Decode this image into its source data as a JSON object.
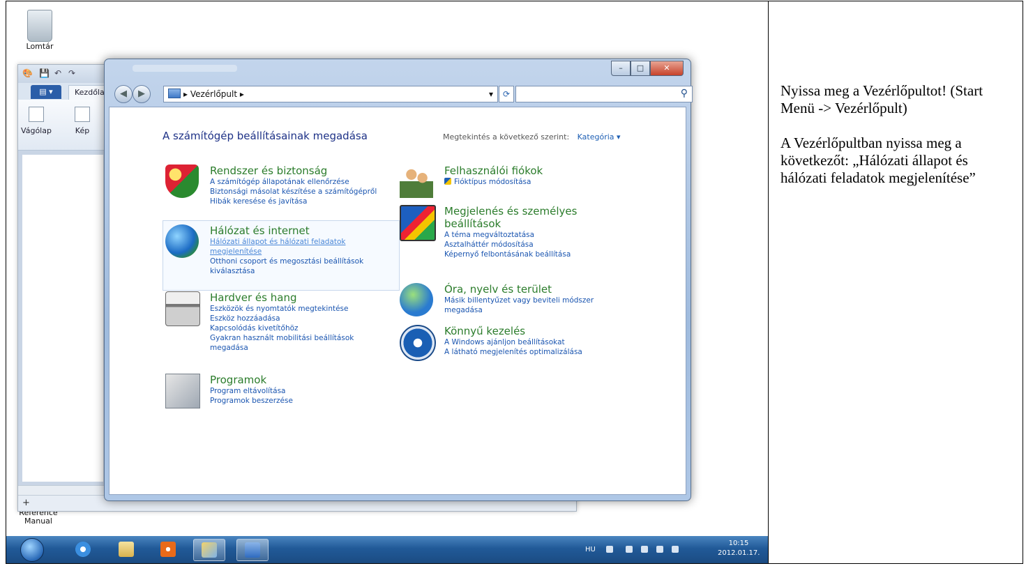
{
  "desktop": {
    "icons": [
      {
        "label": "Lomtár"
      },
      {
        "label": "Reference Manual"
      }
    ]
  },
  "paint": {
    "home_tab": "Kezdőlap",
    "groups": [
      "Vágólap",
      "Kép"
    ],
    "status_text": "+"
  },
  "control_panel": {
    "address": "Vezérlőpult",
    "heading": "A számítógép beállításainak megadása",
    "view_by_label": "Megtekintés a következő szerint:",
    "view_by_value": "Kategória",
    "categories_left": [
      {
        "title": "Rendszer és biztonság",
        "icon": "shield-icon",
        "links": [
          "A számítógép állapotának ellenőrzése",
          "Biztonsági másolat készítése a számítógépről",
          "Hibák keresése és javítása"
        ]
      },
      {
        "title": "Hálózat és internet",
        "icon": "globe-network-icon",
        "links": [
          "Hálózati állapot és hálózati feladatok megjelenítése",
          "Otthoni csoport és megosztási beállítások kiválasztása"
        ]
      },
      {
        "title": "Hardver és hang",
        "icon": "printer-icon",
        "links": [
          "Eszközök és nyomtatók megtekintése",
          "Eszköz hozzáadása",
          "Kapcsolódás kivetítőhöz",
          "Gyakran használt mobilitási beállítások megadása"
        ]
      },
      {
        "title": "Programok",
        "icon": "programs-icon",
        "links": [
          "Program eltávolítása",
          "Programok beszerzése"
        ]
      }
    ],
    "categories_right": [
      {
        "title": "Felhasználói fiókok",
        "icon": "users-icon",
        "links": [
          "Fióktípus módosítása"
        ]
      },
      {
        "title": "Megjelenés és személyes beállítások",
        "icon": "display-icon",
        "links": [
          "A téma megváltoztatása",
          "Asztalháttér módosítása",
          "Képernyő felbontásának beállítása"
        ]
      },
      {
        "title": "Óra, nyelv és terület",
        "icon": "clock-globe-icon",
        "links": [
          "Másik billentyűzet vagy beviteli módszer megadása"
        ]
      },
      {
        "title": "Könnyű kezelés",
        "icon": "ease-of-access-icon",
        "links": [
          "A Windows ajánljon beállításokat",
          "A látható megjelenítés optimalizálása"
        ]
      }
    ]
  },
  "taskbar": {
    "language": "HU",
    "time": "10:15",
    "date": "2012.01.17."
  },
  "instructions": {
    "p1": "Nyissa meg a Vezérlőpultot! (Start Menü -> Vezérlőpult)",
    "p2": "A Vezérlőpultban nyissa meg a következőt: „Hálózati állapot és hálózati feladatok megjelenítése”"
  }
}
